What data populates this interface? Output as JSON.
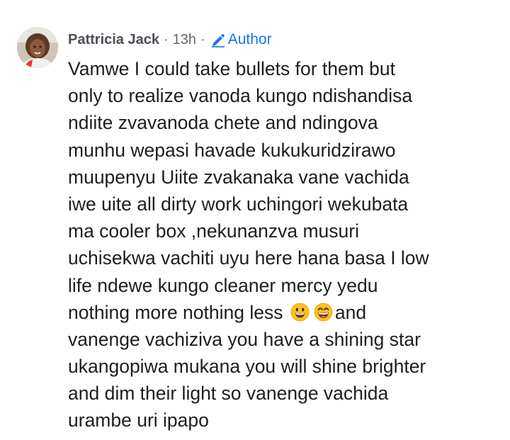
{
  "comment": {
    "author": "Pattricia Jack",
    "separator": "·",
    "timestamp": "13h",
    "badge_label": "Author",
    "badge_icon": "pencil-icon",
    "avatar_icon": "profile-photo",
    "lines": [
      "Vamwe I could take bullets for them  but",
      "only to realize vanoda kungo ndishandisa",
      "ndiite zvavanoda chete and ndingova",
      "munhu wepasi havade kukukuridzirawo",
      "muupenyu Uiite zvakanaka vane vachida",
      "iwe uite all dirty work uchingori wekubata",
      "ma cooler box ,nekunanzva musuri",
      "uchisekwa vachiti uyu here hana basa I low",
      "life ndewe kungo cleaner mercy yedu",
      "nothing more nothing less",
      "and",
      "vanenge vachiziva you have a shining star",
      "ukangopiwa mukana you will shine brighter",
      "and dim their light so vanenge vachida",
      "urambe uri ipapo"
    ],
    "emojis": [
      "grinning-face-emoji",
      "grinning-squinting-face-emoji"
    ],
    "colors": {
      "name": "#4b4f56",
      "meta": "#65676b",
      "badge": "#1b74e4",
      "text": "#1c1e21"
    }
  }
}
